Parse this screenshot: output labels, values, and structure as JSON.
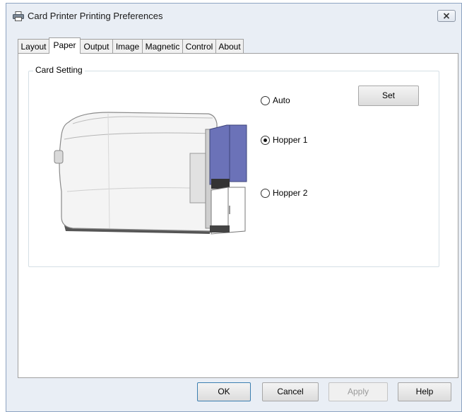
{
  "window": {
    "title": "Card Printer Printing Preferences",
    "icon": "printer-icon",
    "close_icon": "close-icon"
  },
  "tabs": [
    {
      "label": "Layout",
      "active": false
    },
    {
      "label": "Paper",
      "active": true
    },
    {
      "label": "Output",
      "active": false
    },
    {
      "label": "Image",
      "active": false
    },
    {
      "label": "Magnetic",
      "active": false
    },
    {
      "label": "Control",
      "active": false
    },
    {
      "label": "About",
      "active": false
    }
  ],
  "card_setting": {
    "group_label": "Card Setting",
    "set_label": "Set",
    "options": [
      {
        "label": "Auto",
        "checked": false
      },
      {
        "label": "Hopper 1",
        "checked": true
      },
      {
        "label": "Hopper 2",
        "checked": false
      }
    ]
  },
  "footer": {
    "ok_label": "OK",
    "cancel_label": "Cancel",
    "apply_label": "Apply",
    "help_label": "Help"
  },
  "colors": {
    "hopper_accent": "#6b72b8",
    "window_bg": "#e9eef5"
  }
}
